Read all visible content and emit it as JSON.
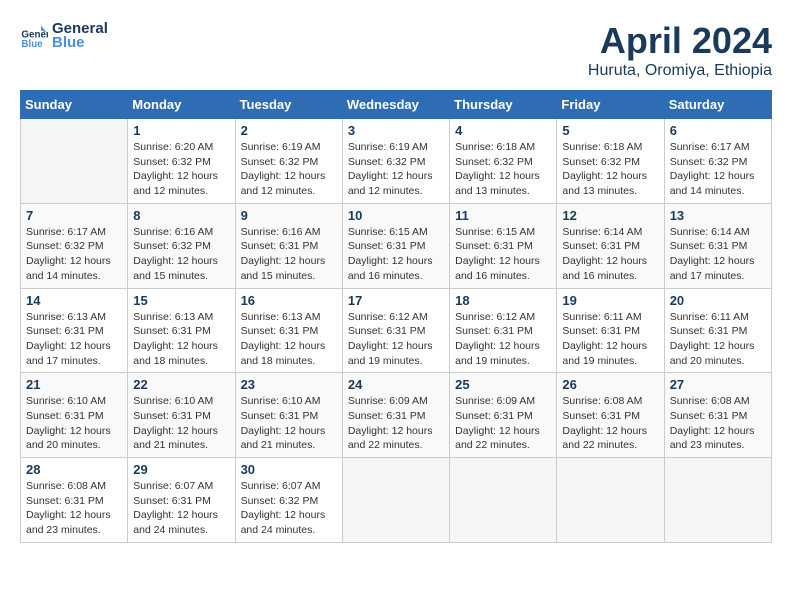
{
  "header": {
    "logo_line1": "General",
    "logo_line2": "Blue",
    "month": "April 2024",
    "location": "Huruta, Oromiya, Ethiopia"
  },
  "weekdays": [
    "Sunday",
    "Monday",
    "Tuesday",
    "Wednesday",
    "Thursday",
    "Friday",
    "Saturday"
  ],
  "weeks": [
    [
      {
        "day": "",
        "info": ""
      },
      {
        "day": "1",
        "info": "Sunrise: 6:20 AM\nSunset: 6:32 PM\nDaylight: 12 hours\nand 12 minutes."
      },
      {
        "day": "2",
        "info": "Sunrise: 6:19 AM\nSunset: 6:32 PM\nDaylight: 12 hours\nand 12 minutes."
      },
      {
        "day": "3",
        "info": "Sunrise: 6:19 AM\nSunset: 6:32 PM\nDaylight: 12 hours\nand 12 minutes."
      },
      {
        "day": "4",
        "info": "Sunrise: 6:18 AM\nSunset: 6:32 PM\nDaylight: 12 hours\nand 13 minutes."
      },
      {
        "day": "5",
        "info": "Sunrise: 6:18 AM\nSunset: 6:32 PM\nDaylight: 12 hours\nand 13 minutes."
      },
      {
        "day": "6",
        "info": "Sunrise: 6:17 AM\nSunset: 6:32 PM\nDaylight: 12 hours\nand 14 minutes."
      }
    ],
    [
      {
        "day": "7",
        "info": "Sunrise: 6:17 AM\nSunset: 6:32 PM\nDaylight: 12 hours\nand 14 minutes."
      },
      {
        "day": "8",
        "info": "Sunrise: 6:16 AM\nSunset: 6:32 PM\nDaylight: 12 hours\nand 15 minutes."
      },
      {
        "day": "9",
        "info": "Sunrise: 6:16 AM\nSunset: 6:31 PM\nDaylight: 12 hours\nand 15 minutes."
      },
      {
        "day": "10",
        "info": "Sunrise: 6:15 AM\nSunset: 6:31 PM\nDaylight: 12 hours\nand 16 minutes."
      },
      {
        "day": "11",
        "info": "Sunrise: 6:15 AM\nSunset: 6:31 PM\nDaylight: 12 hours\nand 16 minutes."
      },
      {
        "day": "12",
        "info": "Sunrise: 6:14 AM\nSunset: 6:31 PM\nDaylight: 12 hours\nand 16 minutes."
      },
      {
        "day": "13",
        "info": "Sunrise: 6:14 AM\nSunset: 6:31 PM\nDaylight: 12 hours\nand 17 minutes."
      }
    ],
    [
      {
        "day": "14",
        "info": "Sunrise: 6:13 AM\nSunset: 6:31 PM\nDaylight: 12 hours\nand 17 minutes."
      },
      {
        "day": "15",
        "info": "Sunrise: 6:13 AM\nSunset: 6:31 PM\nDaylight: 12 hours\nand 18 minutes."
      },
      {
        "day": "16",
        "info": "Sunrise: 6:13 AM\nSunset: 6:31 PM\nDaylight: 12 hours\nand 18 minutes."
      },
      {
        "day": "17",
        "info": "Sunrise: 6:12 AM\nSunset: 6:31 PM\nDaylight: 12 hours\nand 19 minutes."
      },
      {
        "day": "18",
        "info": "Sunrise: 6:12 AM\nSunset: 6:31 PM\nDaylight: 12 hours\nand 19 minutes."
      },
      {
        "day": "19",
        "info": "Sunrise: 6:11 AM\nSunset: 6:31 PM\nDaylight: 12 hours\nand 19 minutes."
      },
      {
        "day": "20",
        "info": "Sunrise: 6:11 AM\nSunset: 6:31 PM\nDaylight: 12 hours\nand 20 minutes."
      }
    ],
    [
      {
        "day": "21",
        "info": "Sunrise: 6:10 AM\nSunset: 6:31 PM\nDaylight: 12 hours\nand 20 minutes."
      },
      {
        "day": "22",
        "info": "Sunrise: 6:10 AM\nSunset: 6:31 PM\nDaylight: 12 hours\nand 21 minutes."
      },
      {
        "day": "23",
        "info": "Sunrise: 6:10 AM\nSunset: 6:31 PM\nDaylight: 12 hours\nand 21 minutes."
      },
      {
        "day": "24",
        "info": "Sunrise: 6:09 AM\nSunset: 6:31 PM\nDaylight: 12 hours\nand 22 minutes."
      },
      {
        "day": "25",
        "info": "Sunrise: 6:09 AM\nSunset: 6:31 PM\nDaylight: 12 hours\nand 22 minutes."
      },
      {
        "day": "26",
        "info": "Sunrise: 6:08 AM\nSunset: 6:31 PM\nDaylight: 12 hours\nand 22 minutes."
      },
      {
        "day": "27",
        "info": "Sunrise: 6:08 AM\nSunset: 6:31 PM\nDaylight: 12 hours\nand 23 minutes."
      }
    ],
    [
      {
        "day": "28",
        "info": "Sunrise: 6:08 AM\nSunset: 6:31 PM\nDaylight: 12 hours\nand 23 minutes."
      },
      {
        "day": "29",
        "info": "Sunrise: 6:07 AM\nSunset: 6:31 PM\nDaylight: 12 hours\nand 24 minutes."
      },
      {
        "day": "30",
        "info": "Sunrise: 6:07 AM\nSunset: 6:32 PM\nDaylight: 12 hours\nand 24 minutes."
      },
      {
        "day": "",
        "info": ""
      },
      {
        "day": "",
        "info": ""
      },
      {
        "day": "",
        "info": ""
      },
      {
        "day": "",
        "info": ""
      }
    ]
  ]
}
